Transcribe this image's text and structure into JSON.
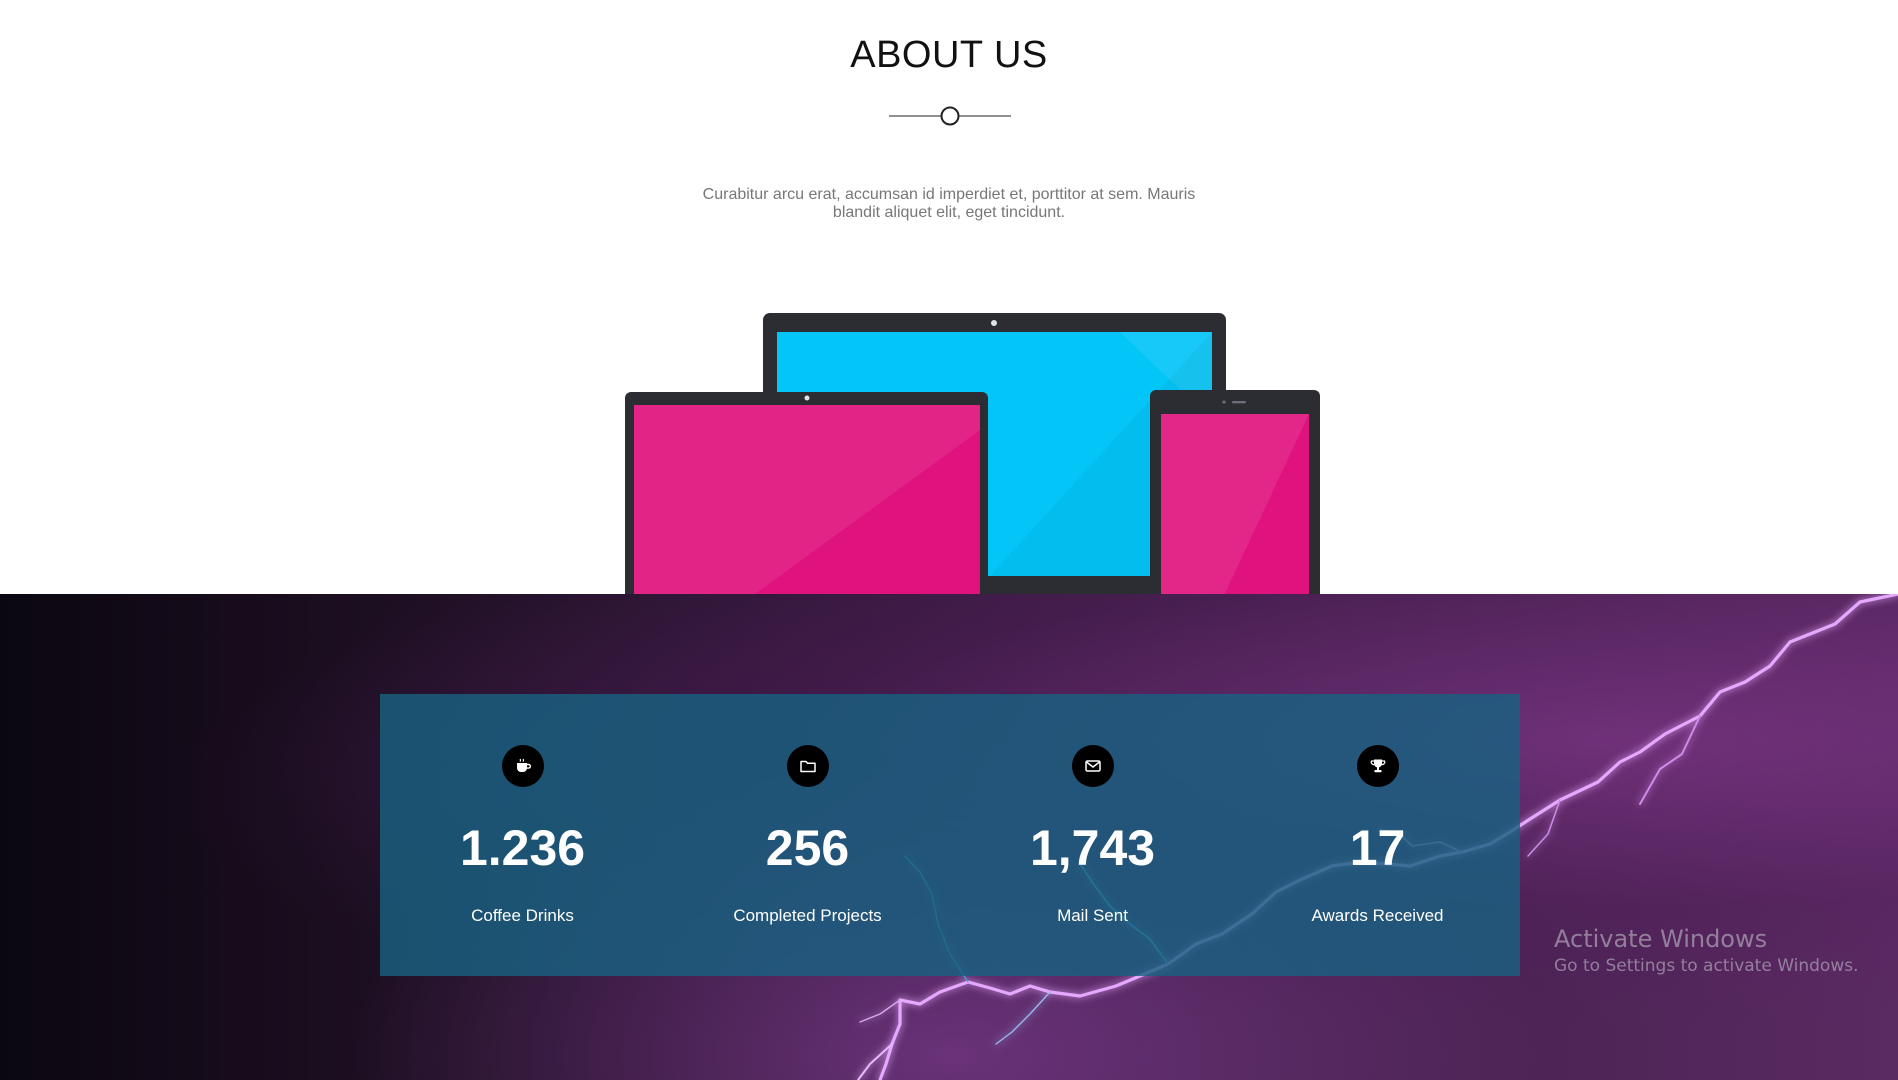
{
  "about": {
    "title": "ABOUT US",
    "description": "Curabitur arcu erat, accumsan id imperdiet et, porttitor at sem. Mauris blandit aliquet elit, eget tincidunt."
  },
  "colors": {
    "laptop_screen": "#04c5f8",
    "tablet_screen": "#e0127d",
    "device_frame": "#2b2d33",
    "stats_panel": "#186080"
  },
  "stats": [
    {
      "icon": "coffee-icon",
      "value": "1.236",
      "label": "Coffee Drinks"
    },
    {
      "icon": "folder-icon",
      "value": "256",
      "label": "Completed Projects"
    },
    {
      "icon": "envelope-icon",
      "value": "1,743",
      "label": "Mail Sent"
    },
    {
      "icon": "trophy-icon",
      "value": "17",
      "label": "Awards Received"
    }
  ],
  "watermark": {
    "title": "Activate Windows",
    "subtitle": "Go to Settings to activate Windows."
  }
}
